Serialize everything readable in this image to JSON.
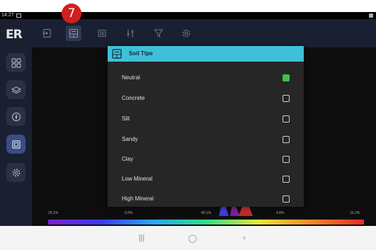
{
  "status": {
    "time": "14:27"
  },
  "app": {
    "logo": "ER"
  },
  "badge": {
    "number": "7"
  },
  "dialog": {
    "title": "Soil Ttpe",
    "options": [
      {
        "label": "Neutral",
        "checked": true
      },
      {
        "label": "Concrete",
        "checked": false
      },
      {
        "label": "Silt",
        "checked": false
      },
      {
        "label": "Sandy",
        "checked": false
      },
      {
        "label": "Clay",
        "checked": false
      },
      {
        "label": "Low Mineral",
        "checked": false
      },
      {
        "label": "High Mineral",
        "checked": false
      }
    ]
  },
  "scale": {
    "ticks": [
      "29.1%",
      "6.8%",
      "49.1%",
      "4.8%",
      "10.2%"
    ]
  },
  "colors": {
    "accent": "#3fc0d8",
    "checked": "#3ac24b",
    "badge": "#d21f1f",
    "sidebar": "#1a2031"
  },
  "icons": {
    "sidebar": [
      "grid-icon",
      "layers-icon",
      "compass-icon",
      "scan-icon",
      "settings-icon"
    ],
    "toolbar": [
      "import-icon",
      "soil-type-icon",
      "battery-icon",
      "sliders-icon",
      "filter-icon",
      "settings-icon"
    ]
  },
  "navbar": {
    "recent": "|||",
    "home": "◯",
    "back": "‹"
  }
}
